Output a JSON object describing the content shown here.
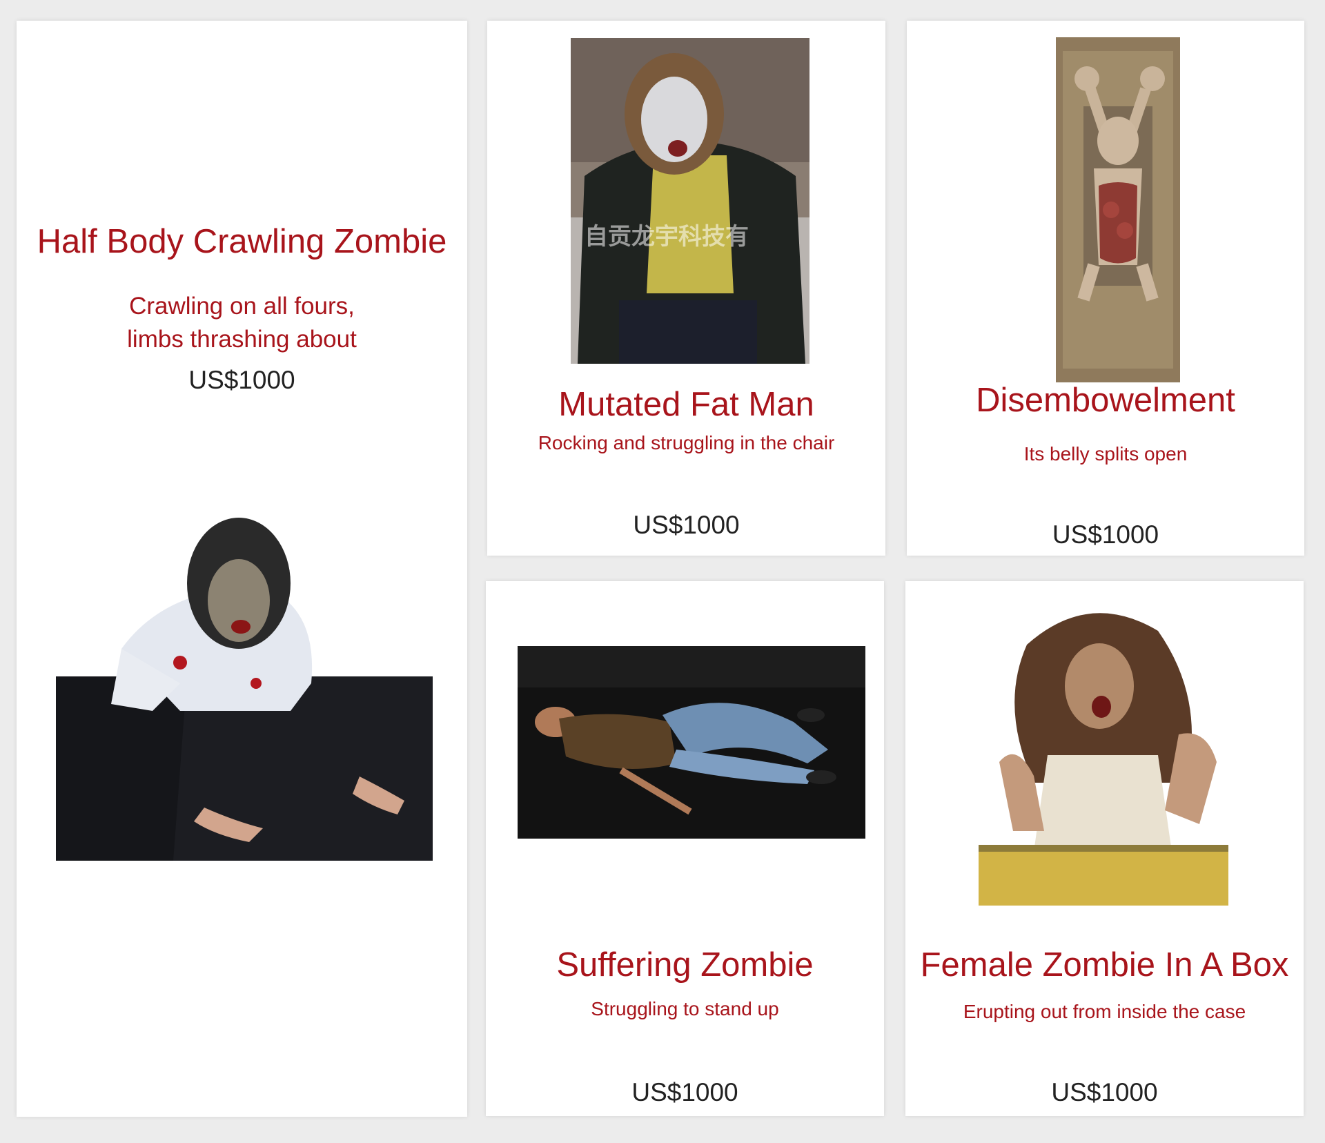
{
  "products": [
    {
      "title": "Half Body Crawling Zombie",
      "description_lines": [
        "Crawling on all fours,",
        "limbs thrashing about"
      ],
      "price": "US$1000",
      "image_icon": "crawling-zombie-photo"
    },
    {
      "title": "Mutated Fat Man",
      "description": "Rocking and struggling in the chair",
      "price": "US$1000",
      "image_icon": "mutated-fat-man-photo",
      "watermark": "自贡龙宇科技有"
    },
    {
      "title": "Disembowelment",
      "description": "Its belly splits open",
      "price": "US$1000",
      "image_icon": "disembowelment-photo"
    },
    {
      "title": "Suffering Zombie",
      "description": "Struggling to stand up",
      "price": "US$1000",
      "image_icon": "suffering-zombie-photo"
    },
    {
      "title": "Female Zombie In A Box",
      "description": "Erupting out from inside the case",
      "price": "US$1000",
      "image_icon": "female-zombie-box-photo"
    }
  ],
  "colors": {
    "accent": "#a8141b",
    "price_text": "#222222",
    "page_background": "#ececec",
    "card_background": "#ffffff"
  }
}
